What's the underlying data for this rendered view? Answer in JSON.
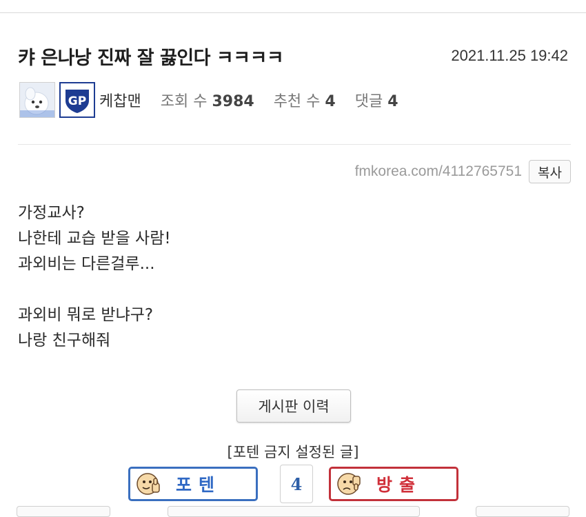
{
  "post": {
    "title": "캬 은나낭 진짜 잘 끓인다 ㅋㅋㅋㅋ",
    "date": "2021.11.25 19:42",
    "author": "케찹맨",
    "stats": {
      "views_label": "조회 수",
      "views": "3984",
      "recommend_label": "추천 수",
      "recommend": "4",
      "comments_label": "댓글",
      "comments": "4"
    },
    "url": "fmkorea.com/4112765751",
    "copy_label": "복사",
    "body_lines": [
      "가정교사?",
      "나한테 교습 받을 사람!",
      "과외비는 다른걸루...",
      "",
      "과외비 뭐로 받냐구?",
      "나랑 친구해줘"
    ]
  },
  "actions": {
    "history_label": "게시판 이력",
    "notice": "[포텐 금지 설정된 글]",
    "upvote_label": "포텐",
    "vote_count": "4",
    "downvote_label": "방출"
  },
  "icons": {
    "avatar": "white-dog-avatar-icon",
    "badge": "gp-team-badge-icon",
    "upvote_face": "thumbs-up-face-icon",
    "downvote_face": "thumbs-down-face-icon"
  },
  "colors": {
    "upvote": "#2f68c4",
    "downvote": "#d0303a",
    "badge": "#1d3c92"
  }
}
